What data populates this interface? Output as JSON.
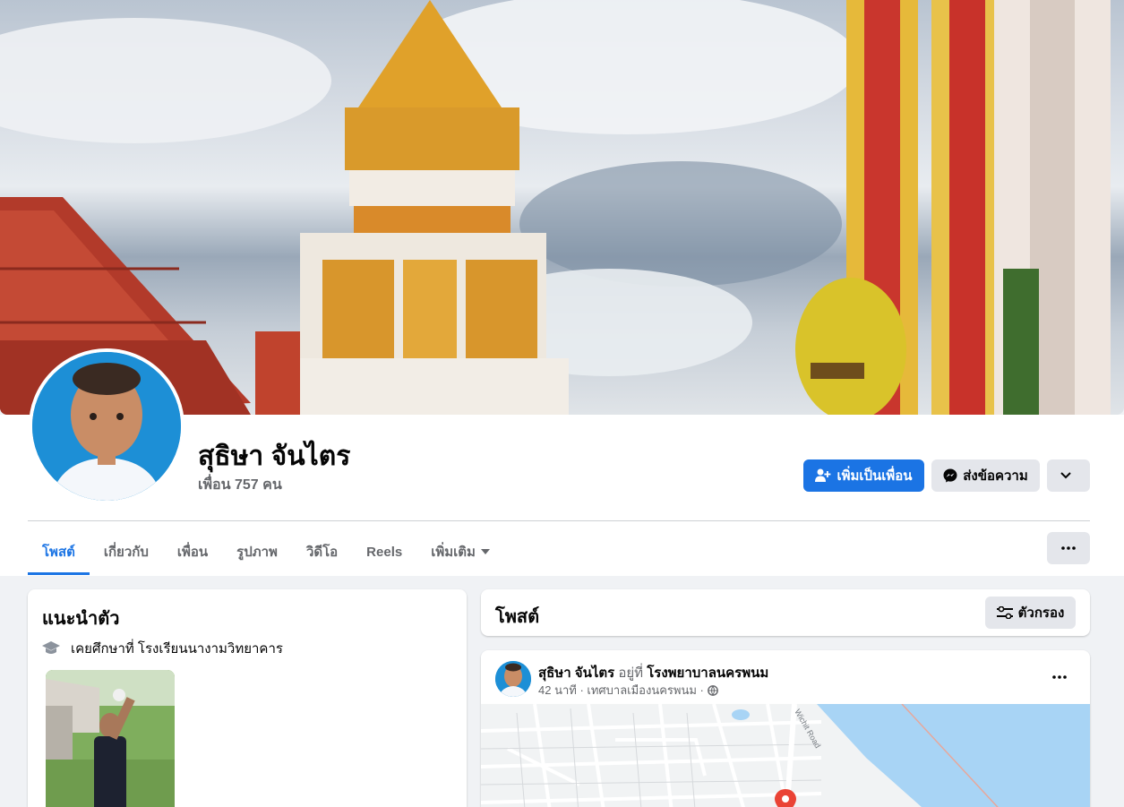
{
  "profile": {
    "name": "สุธิษา จันไตร",
    "friends": "เพื่อน 757 คน"
  },
  "actions": {
    "add_friend": "เพิ่มเป็นเพื่อน",
    "message": "ส่งข้อความ"
  },
  "tabs": [
    {
      "label": "โพสต์",
      "active": true
    },
    {
      "label": "เกี่ยวกับ"
    },
    {
      "label": "เพื่อน"
    },
    {
      "label": "รูปภาพ"
    },
    {
      "label": "วิดีโอ"
    },
    {
      "label": "Reels"
    },
    {
      "label": "เพิ่มเติม"
    }
  ],
  "intro": {
    "title": "แนะนำตัว",
    "education": "เคยศึกษาที่ โรงเรียนนางามวิทยาคาร"
  },
  "posts_section": {
    "title": "โพสต์",
    "filter_label": "ตัวกรอง"
  },
  "post": {
    "author": "สุธิษา จันไตร",
    "at_text": "อยู่ที่",
    "place": "โรงพยาบาลนครพนม",
    "time": "42 นาที",
    "location": "เทศบาลเมืองนครพนม",
    "map_road": "Wichit Road"
  },
  "colors": {
    "primary": "#1b74e4",
    "secondary_button": "#e4e6eb",
    "page_bg": "#f0f2f5",
    "muted_text": "#65676b"
  }
}
